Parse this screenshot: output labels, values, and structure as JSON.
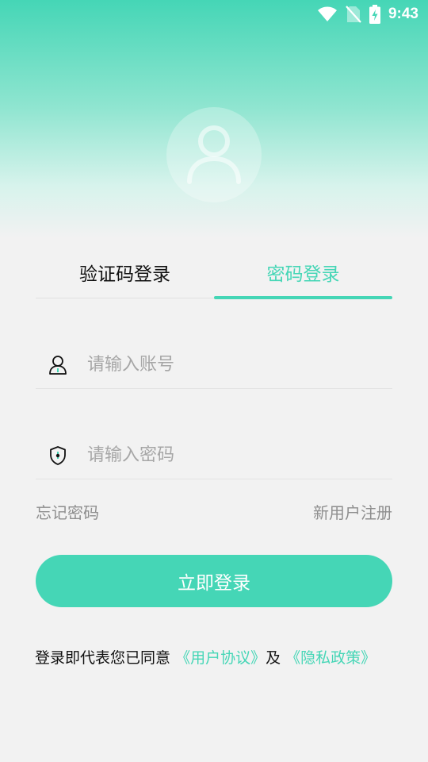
{
  "status_bar": {
    "time": "9:43",
    "icons": [
      "wifi-icon",
      "no-sim-icon",
      "battery-charging-icon"
    ]
  },
  "avatar": {
    "icon": "user-avatar-icon"
  },
  "tabs": [
    {
      "label": "验证码登录",
      "active": false
    },
    {
      "label": "密码登录",
      "active": true
    }
  ],
  "form": {
    "account": {
      "icon": "user-icon",
      "placeholder": "请输入账号",
      "value": ""
    },
    "password": {
      "icon": "shield-lock-icon",
      "placeholder": "请输入密码",
      "value": ""
    }
  },
  "links": {
    "forgot": "忘记密码",
    "register": "新用户注册"
  },
  "login_button": "立即登录",
  "agreement": {
    "prefix": "登录即代表您已同意",
    "user_agreement": "《用户协议》",
    "and": "及",
    "privacy_policy": "《隐私政策》"
  },
  "colors": {
    "accent": "#45d6b6",
    "background": "#f2f2f2",
    "hint": "#a6a6a6"
  }
}
